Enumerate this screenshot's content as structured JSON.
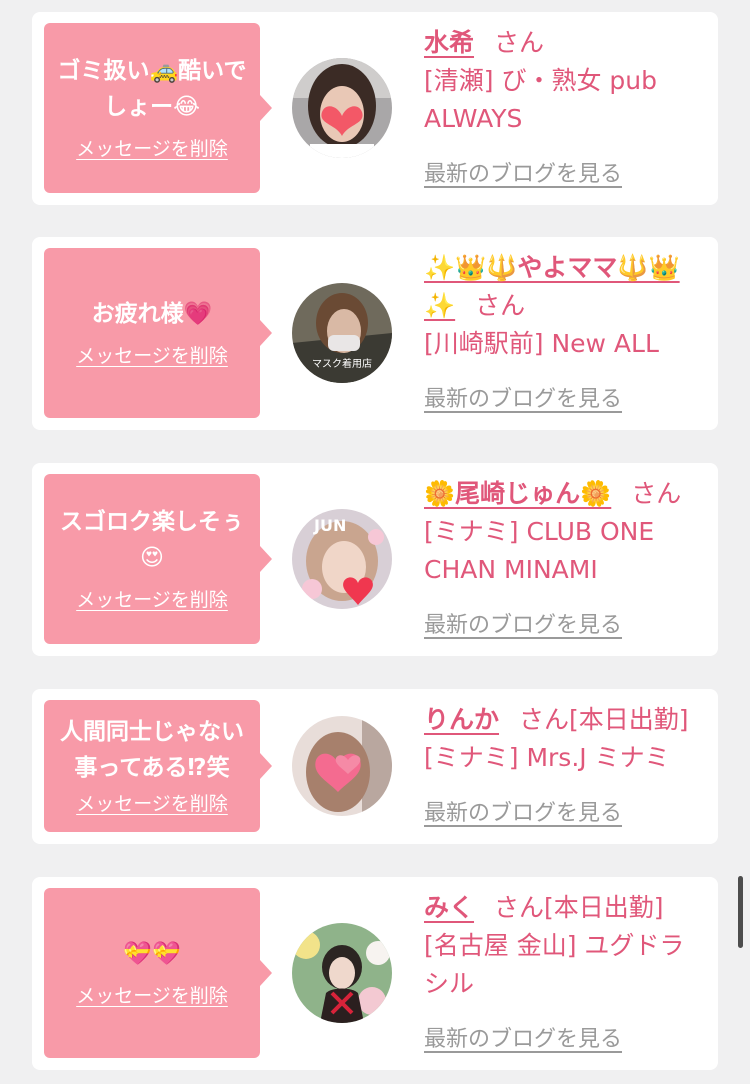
{
  "messages": [
    {
      "message": "ゴミ扱い🚕酷いでしょー😂",
      "delete_label": "メッセージを削除",
      "name": "水希",
      "honorific": "さん",
      "status": "",
      "shop": "[清瀬] び・熟女 pub ALWAYS",
      "blog_label": "最新のブログを見る"
    },
    {
      "message": "お疲れ様💗",
      "delete_label": "メッセージを削除",
      "name": "✨👑🔱やよママ🔱👑✨",
      "honorific": "さん",
      "status": "",
      "shop": "[川崎駅前] New ALL",
      "blog_label": "最新のブログを見る",
      "avatar_caption": "マスク着用店"
    },
    {
      "message": "スゴロク楽しそぅ😍",
      "delete_label": "メッセージを削除",
      "name": "🌼尾崎じゅん🌼",
      "honorific": "さん",
      "status": "",
      "shop": "[ミナミ] CLUB ONE CHAN MINAMI",
      "blog_label": "最新のブログを見る",
      "avatar_caption": "JUN"
    },
    {
      "message": "人間同士じゃない事ってある⁉︎笑",
      "delete_label": "メッセージを削除",
      "name": "りんか",
      "honorific": "さん",
      "status": "[本日出勤]",
      "shop": "[ミナミ] Mrs.J ミナミ",
      "blog_label": "最新のブログを見る"
    },
    {
      "message": "💝💝",
      "delete_label": "メッセージを削除",
      "name": "みく",
      "honorific": "さん",
      "status": "[本日出勤]",
      "shop": "[名古屋 金山] ユグドラシル",
      "blog_label": "最新のブログを見る"
    }
  ],
  "colors": {
    "page_background": "#f0f0f1",
    "card_background": "#ffffff",
    "bubble_pink": "#f89aa8",
    "accent_text": "#e0577a",
    "link_gray": "#9a9a9a"
  }
}
